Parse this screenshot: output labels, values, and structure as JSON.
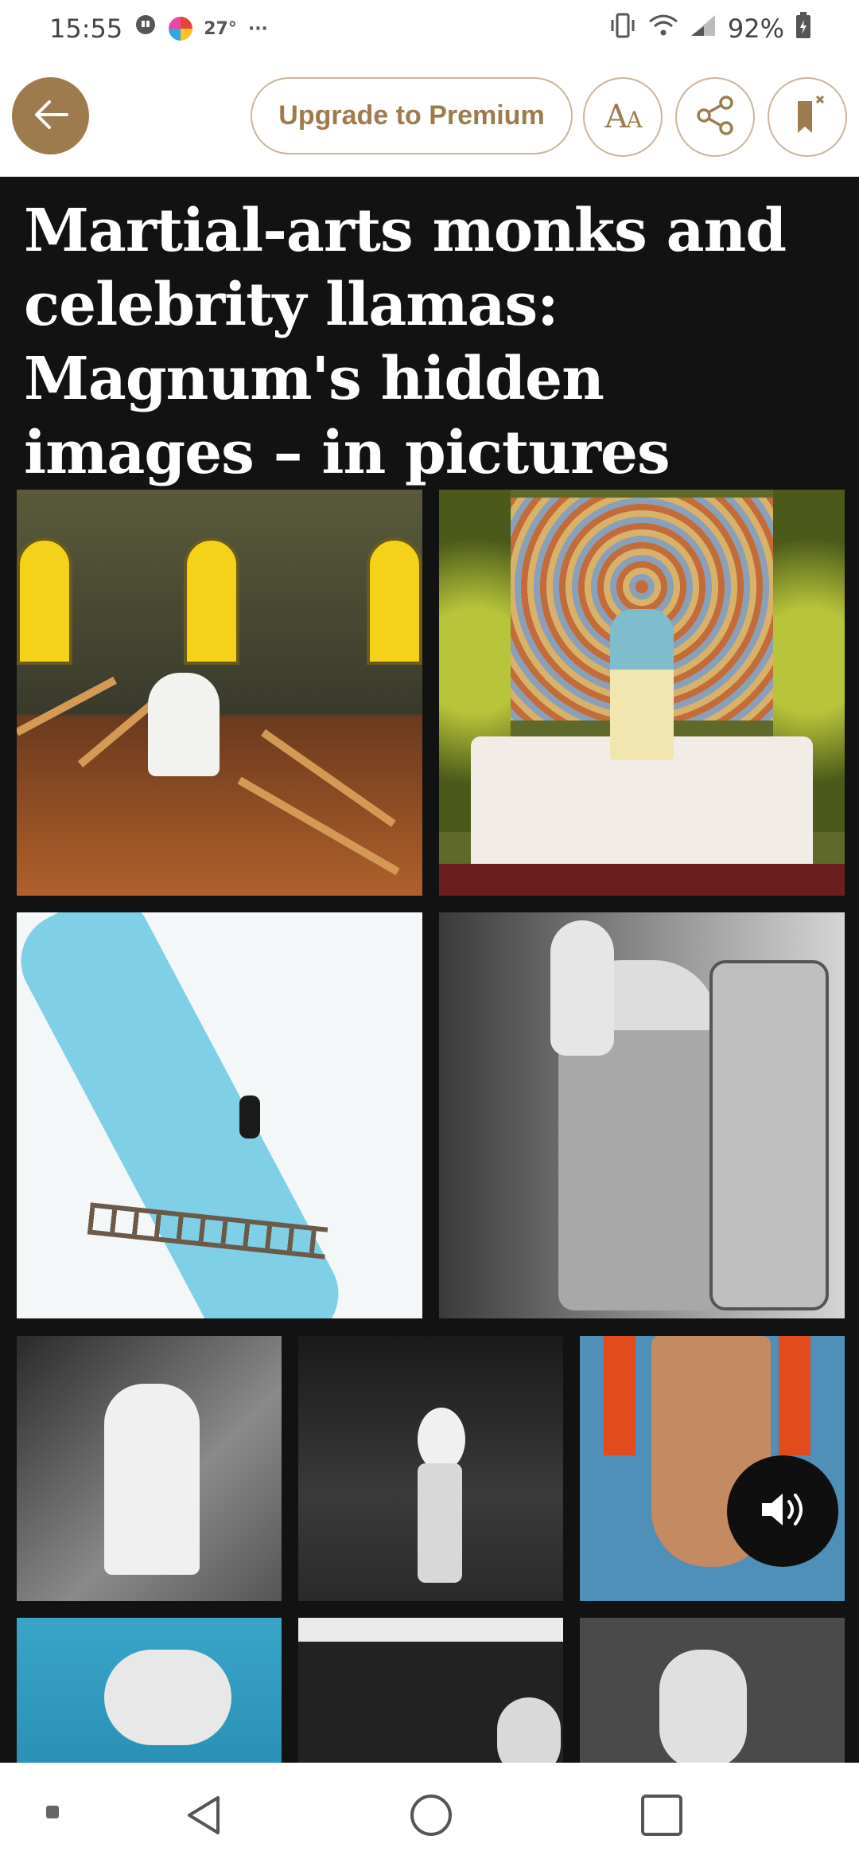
{
  "status_bar": {
    "time": "15:55",
    "temperature": "27°",
    "more": "···",
    "battery": "92%"
  },
  "toolbar": {
    "back_label": "Back",
    "premium_label": "Upgrade to Premium",
    "text_size_label": "AA",
    "share_label": "Share",
    "bookmark_label": "Bookmark"
  },
  "article": {
    "headline": "Martial-arts monks and celebrity llamas: Magnum's hidden images – in pictures",
    "photos": [
      {
        "name": "church-photo"
      },
      {
        "name": "altar-girl-photo"
      },
      {
        "name": "ice-river-photo"
      },
      {
        "name": "llama-car-photo"
      },
      {
        "name": "child-binoculars-photo"
      },
      {
        "name": "balloon-street-photo"
      },
      {
        "name": "upside-down-monk-photo"
      },
      {
        "name": "swimmer-photo"
      },
      {
        "name": "car-portrait-photo"
      },
      {
        "name": "headscarf-woman-photo"
      }
    ]
  },
  "colors": {
    "accent": "#9e7b4f",
    "background": "#121212",
    "headline": "#ffffff",
    "bar": "#ffffff"
  },
  "icons": {
    "back": "arrow-left-icon",
    "share": "share-icon",
    "bookmark": "bookmark-remove-icon",
    "audio": "speaker-icon",
    "nav_back": "triangle-back-icon",
    "nav_home": "circle-home-icon",
    "nav_recents": "square-recents-icon"
  }
}
